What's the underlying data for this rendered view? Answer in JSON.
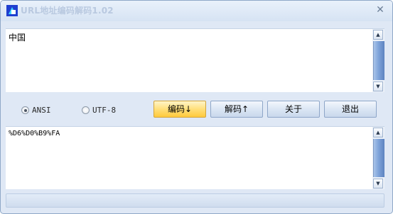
{
  "window": {
    "title": "URL地址编码解码1.02",
    "close_glyph": "✕"
  },
  "input": {
    "value": "中国"
  },
  "output": {
    "value": "%D6%D0%B9%FA"
  },
  "scrollbar": {
    "up_glyph": "▲",
    "down_glyph": "▼"
  },
  "encoding": {
    "options": [
      {
        "label": "ANSI",
        "selected": true
      },
      {
        "label": "UTF-8",
        "selected": false
      }
    ]
  },
  "buttons": {
    "encode": "编码↓",
    "decode": "解码↑",
    "about": "关于",
    "exit": "退出"
  },
  "colors": {
    "accent_button": "#ffd65a",
    "scroll_thumb": "#7ea3d9",
    "frame": "#dfe8f5"
  }
}
